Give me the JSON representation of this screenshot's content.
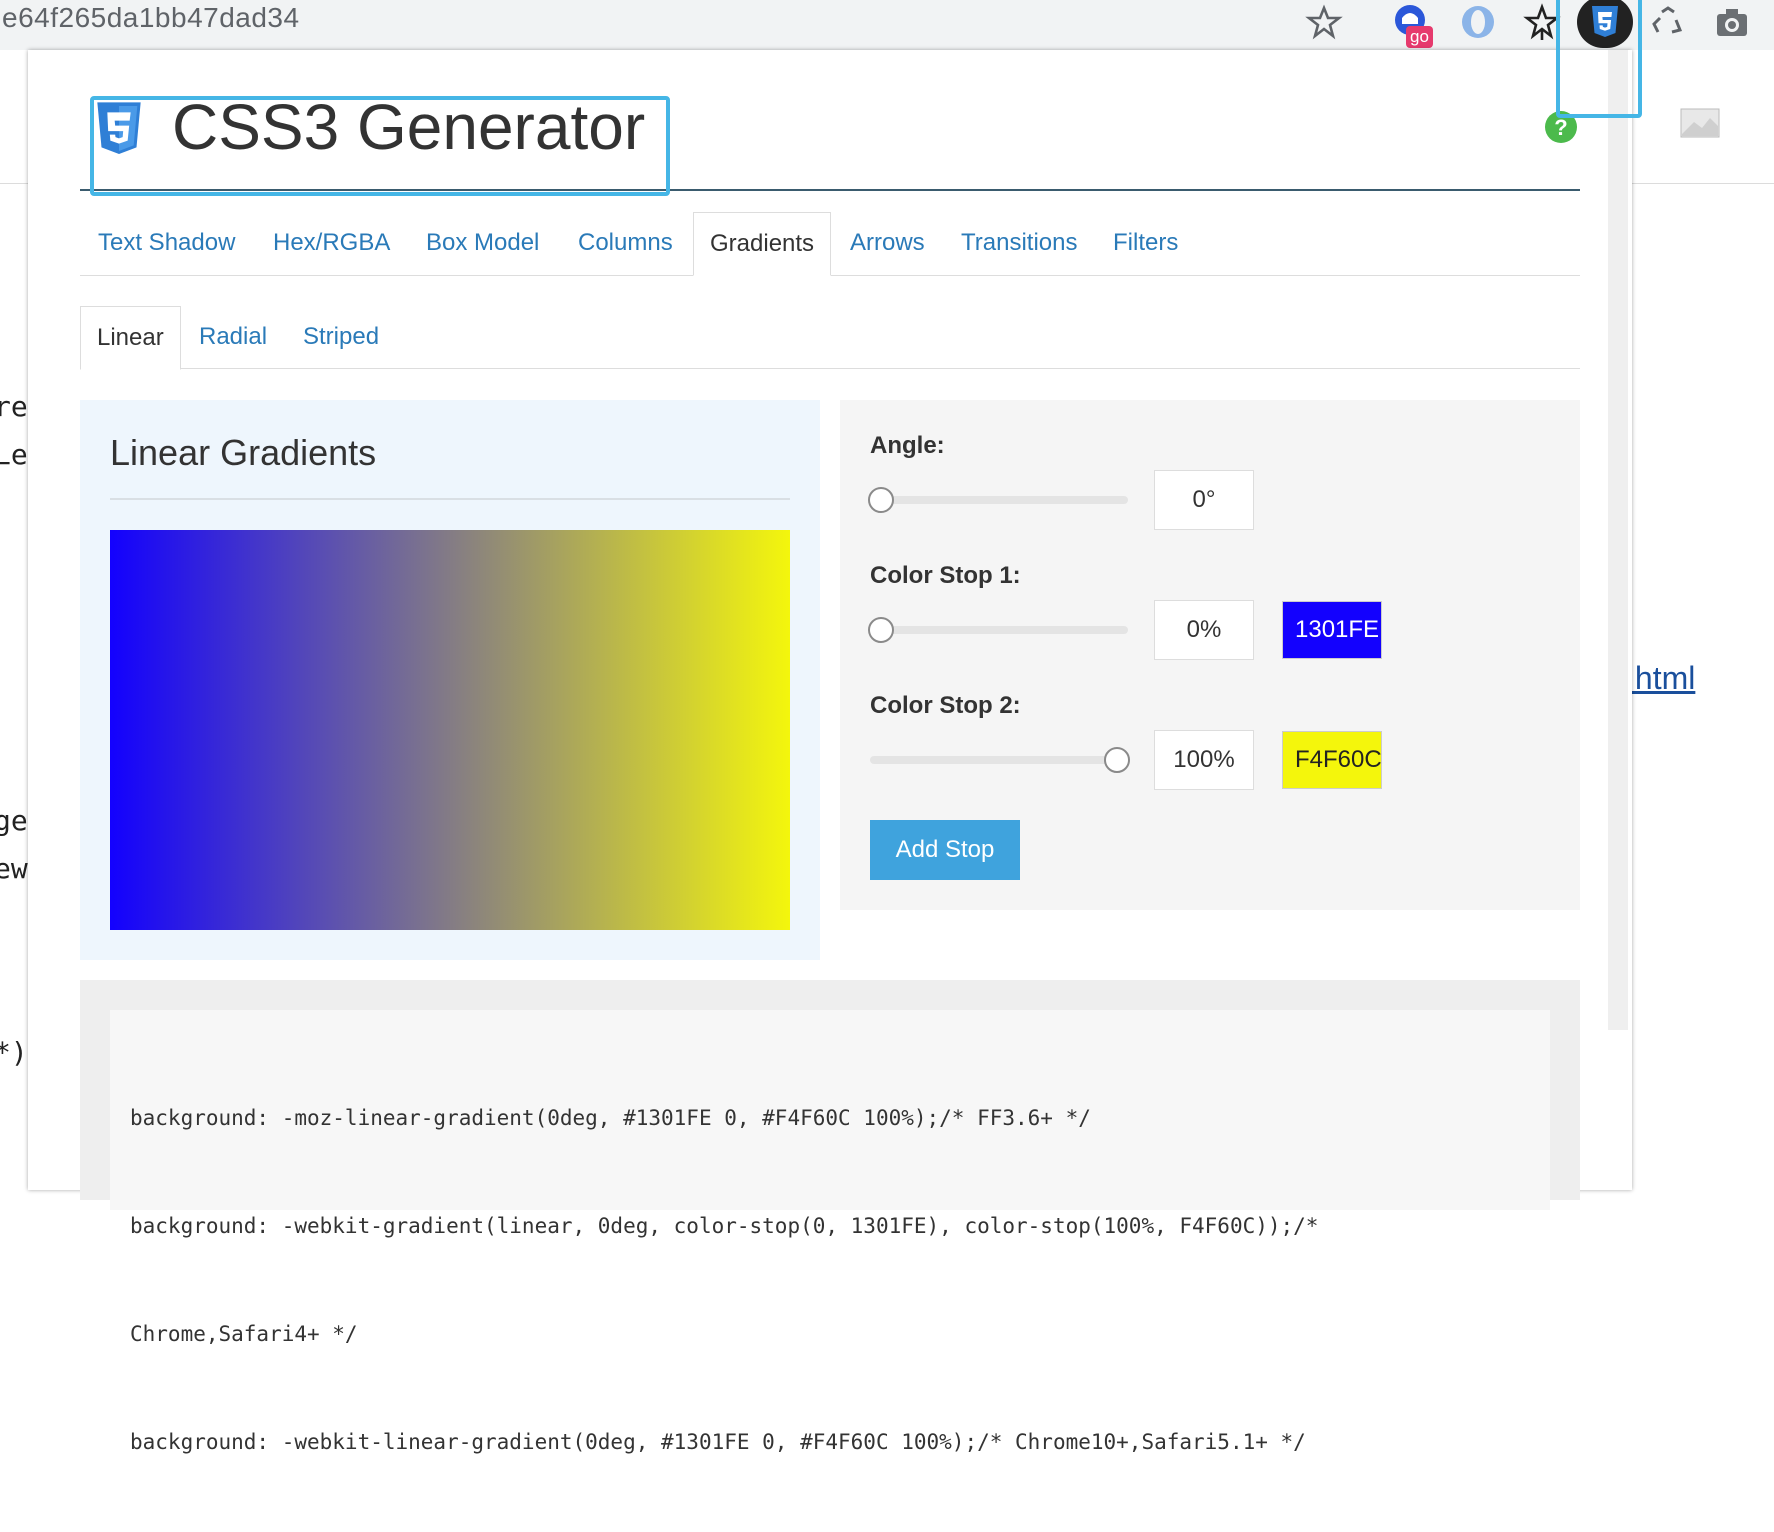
{
  "browser": {
    "url_fragment": "e64f265da1bb47dad34",
    "toolbar_icons": [
      "star-icon",
      "go-extension-icon",
      "opera-icon",
      "pin-extension-icon",
      "css3-extension-icon",
      "recycle-icon",
      "camera-icon"
    ],
    "go_badge": "go"
  },
  "background_page": {
    "fragments": [
      "res",
      "Lev",
      "gex",
      "ew/",
      "*)"
    ],
    "link_text": ".html"
  },
  "app": {
    "title": "CSS3 Generator",
    "tabs": [
      {
        "label": "Text Shadow"
      },
      {
        "label": "Hex/RGBA"
      },
      {
        "label": "Box Model"
      },
      {
        "label": "Columns"
      },
      {
        "label": "Gradients",
        "active": true
      },
      {
        "label": "Arrows"
      },
      {
        "label": "Transitions"
      },
      {
        "label": "Filters"
      }
    ],
    "subtabs": [
      {
        "label": "Linear",
        "active": true
      },
      {
        "label": "Radial"
      },
      {
        "label": "Striped"
      }
    ]
  },
  "preview": {
    "title": "Linear Gradients",
    "gradient_start": "#1301FE",
    "gradient_end": "#F4F60C"
  },
  "controls": {
    "angle_label": "Angle:",
    "angle_value": "0°",
    "angle_fraction": 0,
    "stop1_label": "Color Stop 1:",
    "stop1_value": "0%",
    "stop1_fraction": 0,
    "stop1_color": "1301FE",
    "stop1_color_hex": "#1301FE",
    "stop2_label": "Color Stop 2:",
    "stop2_value": "100%",
    "stop2_fraction": 1,
    "stop2_color": "F4F60C",
    "stop2_color_hex": "#F4F60C",
    "add_stop_label": "Add Stop"
  },
  "code": {
    "lines": [
      "background: -moz-linear-gradient(0deg, #1301FE 0, #F4F60C 100%);/* FF3.6+ */",
      "background: -webkit-gradient(linear, 0deg, color-stop(0, 1301FE), color-stop(100%, F4F60C));/*",
      "Chrome,Safari4+ */",
      "background: -webkit-linear-gradient(0deg, #1301FE 0, #F4F60C 100%);/* Chrome10+,Safari5.1+ */"
    ]
  },
  "colors": {
    "link": "#2a7ab8",
    "accent": "#3fa3dd",
    "highlight": "#45b6e6"
  }
}
